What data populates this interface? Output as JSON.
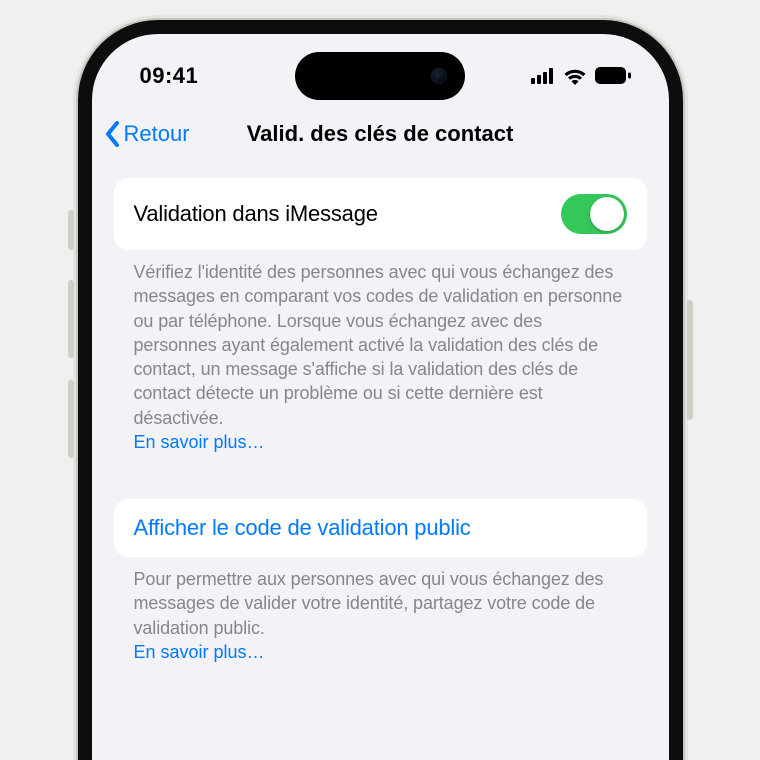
{
  "status": {
    "time": "09:41"
  },
  "nav": {
    "back_label": "Retour",
    "title": "Valid. des clés de contact"
  },
  "section1": {
    "toggle_label": "Validation dans iMessage",
    "toggle_on": true,
    "footer": "Vérifiez l'identité des personnes avec qui vous échangez des messages en comparant vos codes de validation en personne ou par téléphone. Lorsque vous échangez avec des personnes ayant également activé la validation des clés de contact, un message s'affiche si la validation des clés de contact détecte un problème ou si cette dernière est désactivée.",
    "learn_more": "En savoir plus…"
  },
  "section2": {
    "link_label": "Afficher le code de validation public",
    "footer": "Pour permettre aux personnes avec qui vous échangez des messages de valider votre identité, partagez votre code de validation public.",
    "learn_more": "En savoir plus…"
  }
}
